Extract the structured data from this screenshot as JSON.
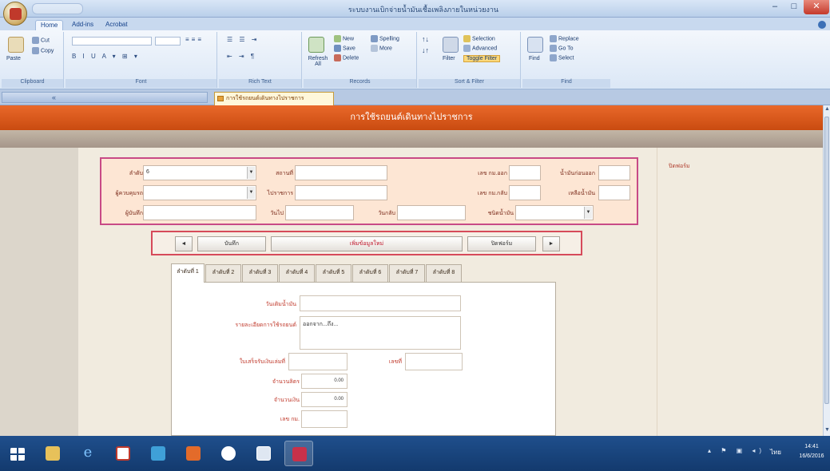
{
  "window": {
    "title": "ระบบงานเบิกจ่ายน้ำมันเชื้อเพลิงภายในหน่วยงาน"
  },
  "ribbon": {
    "tabs": [
      "Home",
      "Add-ins",
      "Acrobat"
    ],
    "groups": {
      "clipboard": {
        "name": "Clipboard",
        "paste": "Paste",
        "cut": "Cut",
        "copy": "Copy"
      },
      "font": {
        "name": "Font"
      },
      "rich_text": {
        "name": "Rich Text"
      },
      "records": {
        "name": "Records",
        "refresh": "Refresh All",
        "new": "New",
        "save": "Save",
        "delete": "Delete",
        "spelling": "Spelling",
        "more": "More"
      },
      "sort_filter": {
        "name": "Sort & Filter",
        "filter": "Filter",
        "selection": "Selection",
        "advanced": "Advanced",
        "toggle_filter": "Toggle Filter"
      },
      "find": {
        "name": "Find",
        "find": "Find",
        "replace": "Replace",
        "goto": "Go To",
        "select": "Select"
      }
    }
  },
  "doc_tab": {
    "label": "การใช้รถยนต์เดินทางไปราชการ"
  },
  "form": {
    "header": "การใช้รถยนต์เดินทางไปราชการ",
    "side_link": "ปิดฟอร์ม",
    "info": {
      "record_label": "ลำดับ",
      "record_value": "6",
      "driver_label": "ผู้ควบคุมรถ",
      "reporter_label": "ผู้บันทึก",
      "place_label": "สถานที่",
      "purpose_label": "ไปราชการ",
      "date_go_label": "วันไป",
      "date_back_label": "วันกลับ",
      "mileage_out_label": "เลข กม.ออก",
      "mileage_in_label": "เลข กม.กลับ",
      "fuel_out_label": "น้ำมันก่อนออก",
      "fuel_in_label": "เหลือน้ำมัน",
      "fuel_type_label": "ชนิดน้ำมัน"
    },
    "nav": {
      "prev": "◄",
      "save": "บันทึก",
      "center": "เพิ่มข้อมูลใหม่",
      "close": "ปิดฟอร์ม",
      "next": "►"
    },
    "tabs": [
      "ลำดับที่ 1",
      "ลำดับที่ 2",
      "ลำดับที่ 3",
      "ลำดับที่ 4",
      "ลำดับที่ 5",
      "ลำดับที่ 6",
      "ลำดับที่ 7",
      "ลำดับที่ 8"
    ],
    "detail": {
      "fill_date_label": "วันเติมน้ำมัน",
      "usage_label": "รายละเอียดการใช้รถยนต์",
      "usage_value": "ออกจาก...ถึง...",
      "receipt_label": "ใบเสร็จรับเงินเล่มที่",
      "number_label": "เลขที่",
      "liters_label": "จำนวนลิตร",
      "liters_value": "0.00",
      "amount_label": "จำนวนเงิน",
      "amount_value": "0.00",
      "km_label": "เลข กม."
    }
  },
  "taskbar": {
    "apps": [
      "start",
      "file-explorer",
      "internet-explorer",
      "acrobat",
      "media",
      "access",
      "media-player",
      "paint",
      "tools"
    ],
    "time": "14:41",
    "date": "16/6/2016",
    "lang": "ไทย"
  },
  "colors": {
    "header": "#d95a1c",
    "panel_border": "#c84a86",
    "nav_border": "#d64a5a",
    "label_red": "#c0392b",
    "taskbar": "#1a467f"
  }
}
